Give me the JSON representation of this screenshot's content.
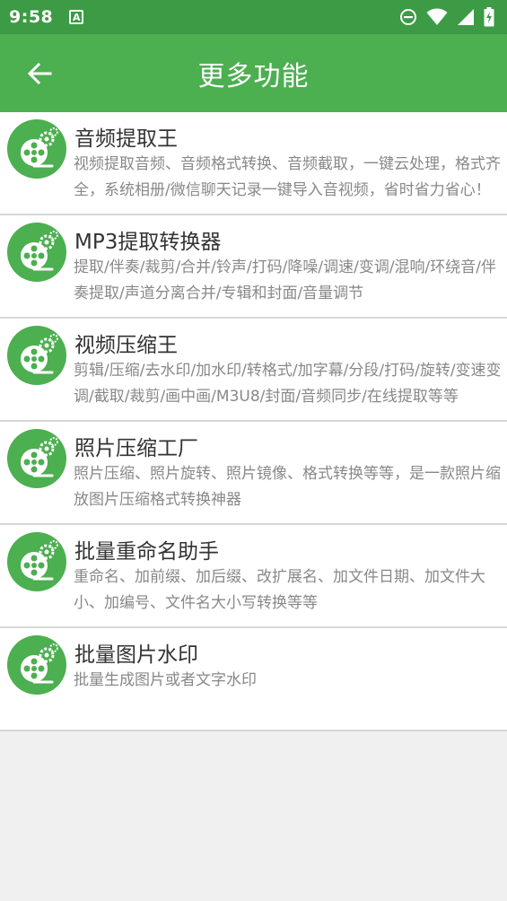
{
  "status_bar": {
    "time": "9:58",
    "notification_icon": "a-letter-icon",
    "icons": [
      "do-not-disturb-icon",
      "wifi-icon",
      "cell-signal-icon",
      "battery-charging-icon"
    ]
  },
  "app_bar": {
    "title": "更多功能",
    "back_icon": "arrow-left-icon"
  },
  "colors": {
    "status_bar": "#3c9b44",
    "app_bar": "#4caf50",
    "icon_green": "#4caf50"
  },
  "items": [
    {
      "title": "音频提取王",
      "desc": "视频提取音频、音频格式转换、音频截取，一键云处理，格式齐全，系统相册/微信聊天记录一键导入音视频，省时省力省心！",
      "icon": "film-reel-gear-icon"
    },
    {
      "title": "MP3提取转换器",
      "desc": "提取/伴奏/裁剪/合并/铃声/打码/降噪/调速/变调/混响/环绕音/伴奏提取/声道分离合并/专辑和封面/音量调节",
      "icon": "film-reel-gear-icon"
    },
    {
      "title": "视频压缩王",
      "desc": "剪辑/压缩/去水印/加水印/转格式/加字幕/分段/打码/旋转/变速变调/截取/裁剪/画中画/M3U8/封面/音频同步/在线提取等等",
      "icon": "film-reel-gear-icon"
    },
    {
      "title": "照片压缩工厂",
      "desc": "照片压缩、照片旋转、照片镜像、格式转换等等，是一款照片缩放图片压缩格式转换神器",
      "icon": "film-reel-gear-icon"
    },
    {
      "title": "批量重命名助手",
      "desc": "重命名、加前缀、加后缀、改扩展名、加文件日期、加文件大小、加编号、文件名大小写转换等等",
      "icon": "film-reel-gear-icon"
    },
    {
      "title": "批量图片水印",
      "desc": "批量生成图片或者文字水印",
      "icon": "film-reel-gear-icon"
    }
  ]
}
